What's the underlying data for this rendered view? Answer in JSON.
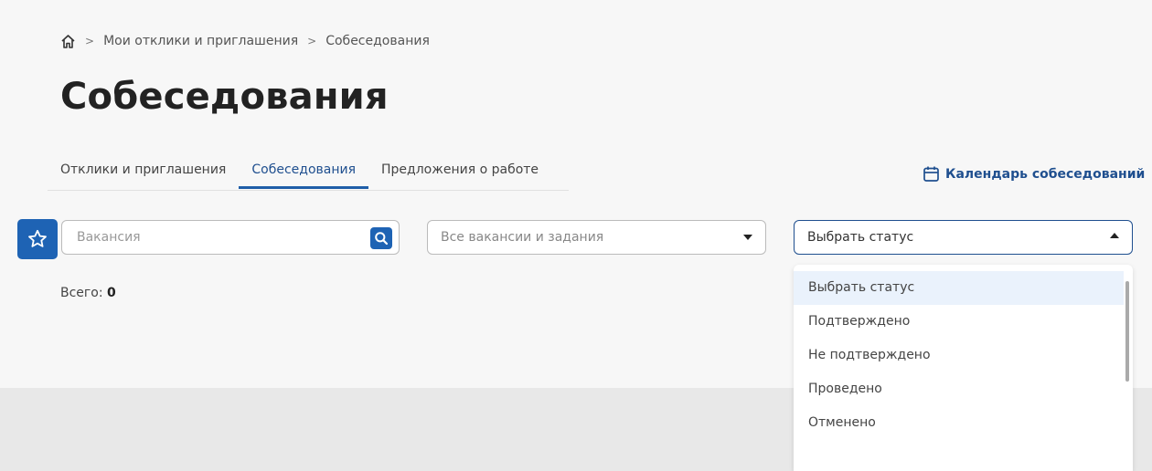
{
  "breadcrumb": {
    "home_icon": "home-icon",
    "separator": ">",
    "items": [
      "Мои отклики и приглашения",
      "Собеседования"
    ]
  },
  "page_title": "Собеседования",
  "tabs": [
    {
      "label": "Отклики и приглашения",
      "active": false
    },
    {
      "label": "Собеседования",
      "active": true
    },
    {
      "label": "Предложения о работе",
      "active": false
    }
  ],
  "calendar_link": {
    "icon": "calendar-icon",
    "label": "Календарь собеседований"
  },
  "filters": {
    "favorite_icon": "star-icon",
    "search": {
      "placeholder": "Вакансия",
      "value": "",
      "icon": "search-icon"
    },
    "vacancy_select": {
      "value": "Все вакансии и задания"
    },
    "status_select": {
      "value": "Выбрать статус",
      "open": true,
      "options": [
        "Выбрать статус",
        "Подтверждено",
        "Не подтверждено",
        "Проведено",
        "Отменено"
      ]
    }
  },
  "total": {
    "label": "Всего:",
    "count": "0"
  },
  "colors": {
    "accent": "#1e63b4",
    "link": "#1f4f8f",
    "selected_option_bg": "#eaf2fc"
  }
}
